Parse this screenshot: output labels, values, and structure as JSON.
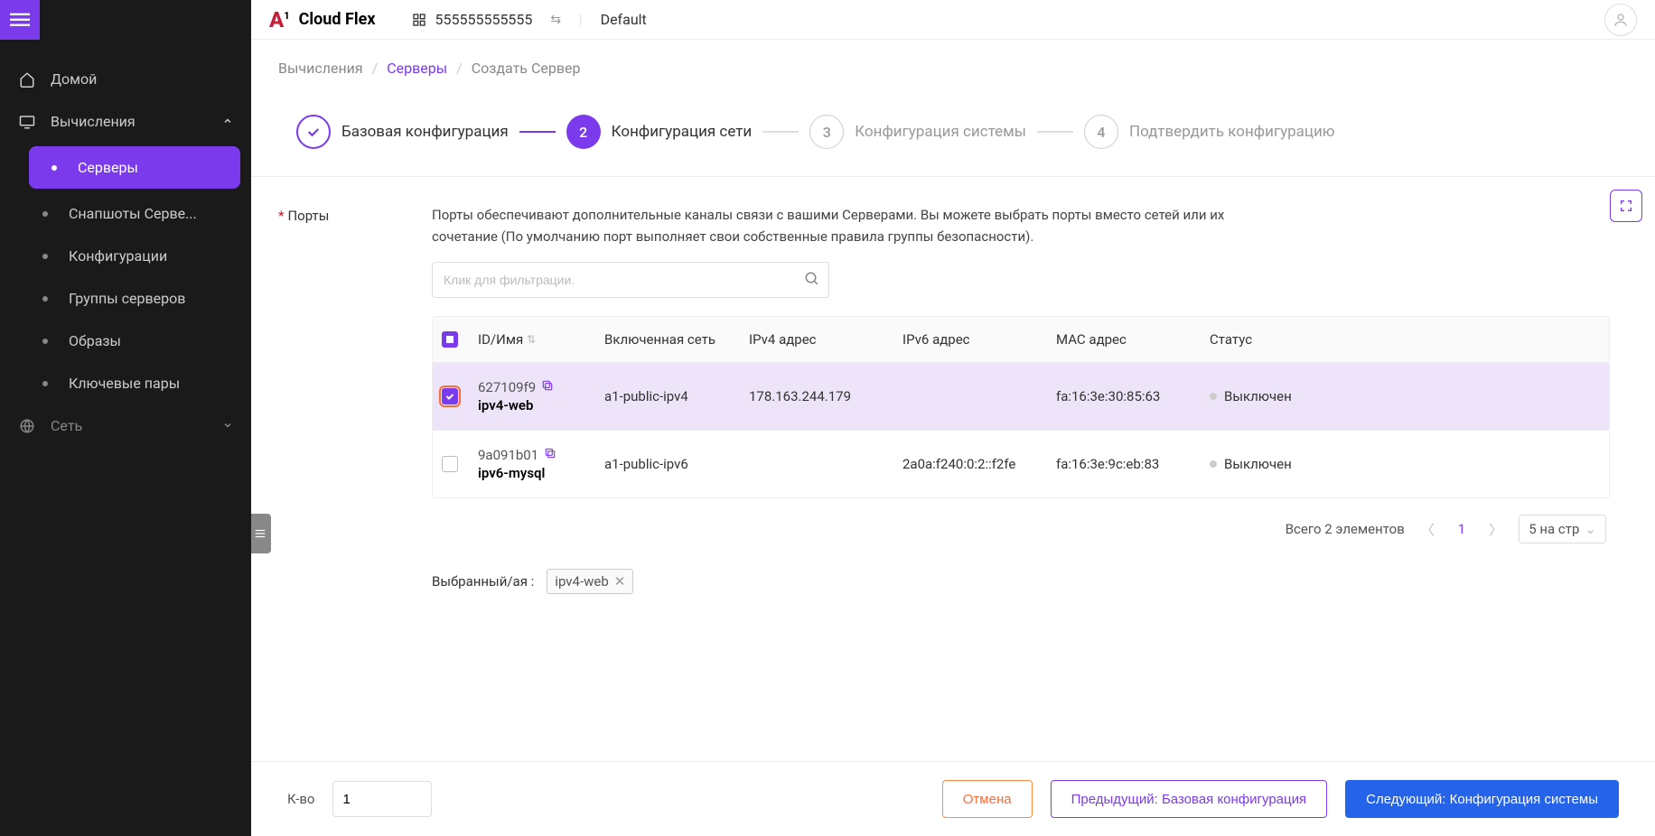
{
  "brand": {
    "name": "Cloud Flex"
  },
  "topbar": {
    "account_id": "555555555555",
    "project": "Default"
  },
  "sidebar": {
    "home": "Домой",
    "compute": "Вычисления",
    "servers": "Серверы",
    "snapshots": "Снапшоты Серве...",
    "configs": "Конфигурации",
    "groups": "Группы серверов",
    "images": "Образы",
    "keypairs": "Ключевые пары",
    "network": "Сеть"
  },
  "breadcrumb": {
    "compute": "Вычисления",
    "servers": "Серверы",
    "create": "Создать Сервер"
  },
  "steps": {
    "s1": "Базовая конфигурация",
    "s2": "Конфигурация сети",
    "s3": "Конфигурация системы",
    "s4": "Подтвердить конфигурацию",
    "n2": "2",
    "n3": "3",
    "n4": "4"
  },
  "section": {
    "label": "Порты",
    "description": "Порты обеспечивают дополнительные каналы связи с вашими Серверами. Вы можете выбрать порты вместо сетей или их сочетание (По умолчанию порт выполняет свои собственные правила группы безопасности).",
    "filter_placeholder": "Клик для фильтрации."
  },
  "table": {
    "headers": {
      "id": "ID/Имя",
      "net": "Включенная сеть",
      "ipv4": "IPv4 адрес",
      "ipv6": "IPv6 адрес",
      "mac": "MAC адрес",
      "status": "Статус"
    },
    "rows": [
      {
        "selected": true,
        "id": "627109f9",
        "name": "ipv4-web",
        "net": "a1-public-ipv4",
        "ipv4": "178.163.244.179",
        "ipv6": "",
        "mac": "fa:16:3e:30:85:63",
        "status": "Выключен"
      },
      {
        "selected": false,
        "id": "9a091b01",
        "name": "ipv6-mysql",
        "net": "a1-public-ipv6",
        "ipv4": "",
        "ipv6": "2a0a:f240:0:2::f2fe",
        "mac": "fa:16:3e:9c:eb:83",
        "status": "Выключен"
      }
    ]
  },
  "pagination": {
    "total_label": "Всего 2 элементов",
    "page": "1",
    "size_label": "5 на стр"
  },
  "selected": {
    "label": "Выбранный/ая :",
    "tag": "ipv4-web"
  },
  "footer": {
    "qty_label": "К-во",
    "qty_value": "1",
    "cancel": "Отмена",
    "prev": "Предыдущий: Базовая конфигурация",
    "next": "Следующий: Конфигурация системы"
  }
}
